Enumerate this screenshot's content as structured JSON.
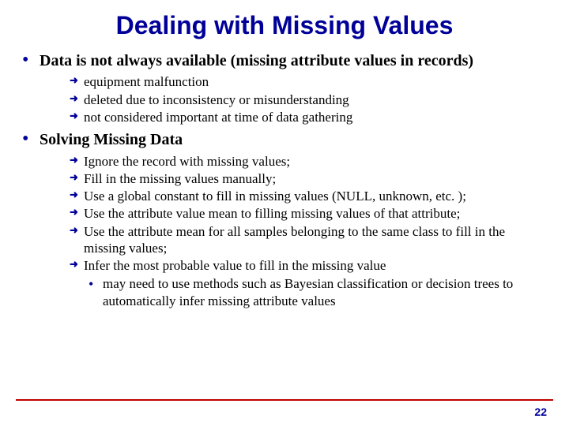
{
  "title": "Dealing with Missing Values",
  "points": [
    {
      "text": "Data is not always available (missing attribute values in records)",
      "subs": [
        {
          "text": "equipment malfunction"
        },
        {
          "text": "deleted due to inconsistency or misunderstanding"
        },
        {
          "text": "not considered important at time of data gathering"
        }
      ]
    },
    {
      "text": "Solving Missing Data",
      "subs": [
        {
          "text": "Ignore the record with missing values;"
        },
        {
          "text": "Fill in the missing values manually;"
        },
        {
          "text": "Use a global constant to fill in missing values (NULL, unknown, etc. );"
        },
        {
          "text": "Use the attribute value mean to filling missing values of that attribute;"
        },
        {
          "text": "Use the attribute mean for all samples belonging to the same class to fill in the missing values;"
        },
        {
          "text": "Infer the most probable value to fill in the missing value",
          "subs": [
            {
              "text": "may need to use methods such as Bayesian classification or decision trees to automatically infer missing attribute values"
            }
          ]
        }
      ]
    }
  ],
  "page_number": "22"
}
